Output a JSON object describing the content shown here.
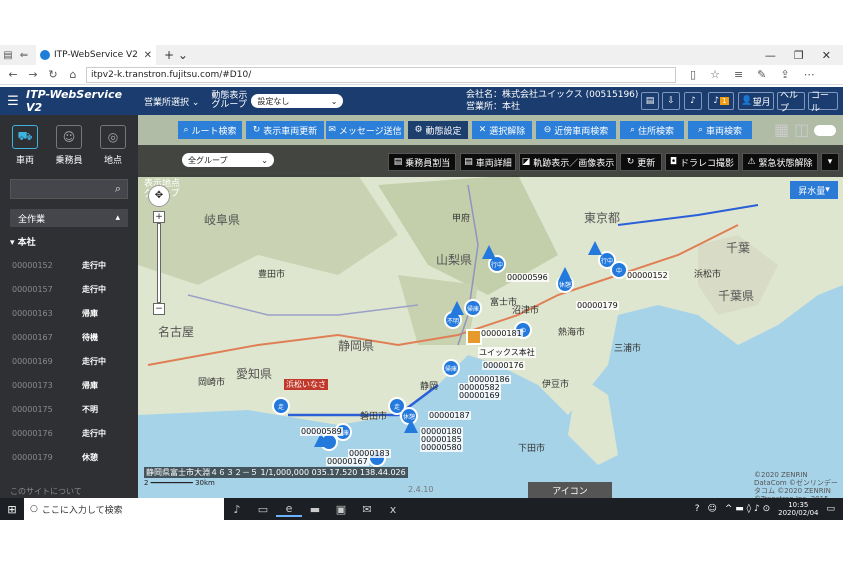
{
  "browser": {
    "tab_title": "ITP-WebService V2",
    "url": "itpv2-k.transtron.fujitsu.com/#D10/"
  },
  "header": {
    "app_title": "ITP-WebService V2",
    "office_select_label": "営業所選択",
    "display_group_label": "動態表示グループ",
    "display_group_value": "設定なし",
    "company_line": "会社名：株式会社ユイックス (00515196)",
    "office_line": "営業所：本社",
    "notification_count": "1",
    "user_label": "望月",
    "help_label": "ヘルプ",
    "call_label": "コール"
  },
  "sidebar": {
    "tabs": [
      {
        "label": "車両",
        "icon": "truck-icon"
      },
      {
        "label": "乗務員",
        "icon": "person-icon"
      },
      {
        "label": "地点",
        "icon": "location-icon"
      }
    ],
    "search_placeholder": "",
    "group_label": "全作業",
    "section_label": "本社",
    "vehicles": [
      {
        "id": "00000152",
        "status": "走行中"
      },
      {
        "id": "00000157",
        "status": "走行中"
      },
      {
        "id": "00000163",
        "status": "帰庫"
      },
      {
        "id": "00000167",
        "status": "待機"
      },
      {
        "id": "00000169",
        "status": "走行中"
      },
      {
        "id": "00000173",
        "status": "帰庫"
      },
      {
        "id": "00000175",
        "status": "不明"
      },
      {
        "id": "00000176",
        "status": "走行中"
      },
      {
        "id": "00000179",
        "status": "休憩"
      }
    ],
    "footer_link": "このサイトについて"
  },
  "toolbar1": {
    "route_search": "ルート検索",
    "vehicle_update": "表示車両更新",
    "message_send": "メッセージ送信",
    "motion_settings": "動態設定",
    "clear_selection": "選択解除",
    "nearby_search": "近傍車両検索",
    "address_search": "住所検索",
    "vehicle_search": "車両検索"
  },
  "toolbar2": {
    "display_point_group_label": "表示地点グループ",
    "display_point_group_value": "全グループ",
    "crew_assign": "乗務員割当",
    "vehicle_detail": "車両詳細",
    "track_display": "軌跡表示／画像表示",
    "refresh": "更新",
    "dorareco": "ドラレコ撮影",
    "emergency_clear": "緊急状態解除"
  },
  "map": {
    "style_button": "昇水量",
    "prefectures": [
      "岐阜県",
      "山梨県",
      "静岡県",
      "愛知県",
      "東京都",
      "千葉",
      "千葉県"
    ],
    "cities": [
      "名古屋",
      "静岡",
      "甲府",
      "浜松市",
      "豊田市",
      "岡崎市",
      "三浦市",
      "伊豆市",
      "下田市",
      "熱海市",
      "磐田市",
      "沼津市",
      "富士市"
    ],
    "vehicle_labels": [
      "00000596",
      "00000152",
      "00000179",
      "00000181",
      "00000176",
      "00000186",
      "00000582",
      "00000169",
      "00000187",
      "00000589",
      "00000180",
      "00000185",
      "00000580",
      "00000183",
      "00000167"
    ],
    "office_label": "ユイックス本社",
    "coordinates": "静岡県富士市大淵４６３２－５ 1/1,000,000 035.17.520 138.44.026",
    "scale": "30km",
    "version": "2.4.10",
    "icon_tab": "アイコン",
    "copyright": "©2020 ZENRIN DataCom ©ゼンリンデータコム ©2020 ZENRIN ©Transtron Inc. 2015",
    "warning_label": "浜松いなさ"
  },
  "taskbar": {
    "search_placeholder": "ここに入力して検索",
    "time": "10:35",
    "date": "2020/02/04"
  },
  "colors": {
    "header_bg": "#1a3c6e",
    "sidebar_bg": "#2f3034",
    "accent_blue": "#2c7fd8",
    "pin_blue": "#2479dc"
  }
}
